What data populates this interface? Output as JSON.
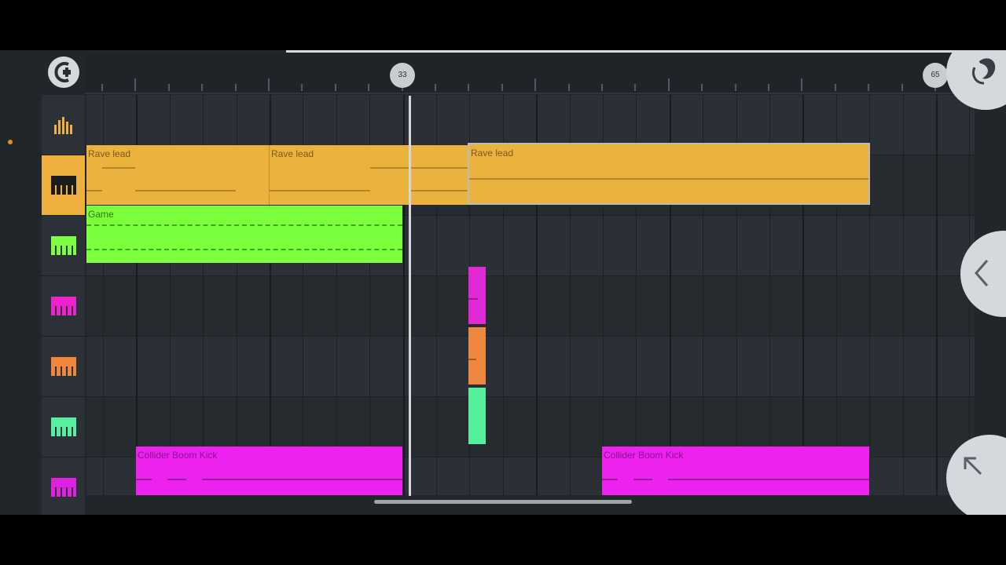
{
  "ruler": {
    "markers": [
      {
        "label": "33"
      },
      {
        "label": "65"
      }
    ]
  },
  "channels": [
    {
      "icon": "levels-icon",
      "color": "#f0b040"
    },
    {
      "icon": "piano-keys-icon",
      "color": "#1c1c1c"
    },
    {
      "icon": "piano-keys-icon",
      "color": "#7cff42"
    },
    {
      "icon": "piano-keys-icon",
      "color": "#ee22cc"
    },
    {
      "icon": "piano-keys-icon",
      "color": "#f0863c"
    },
    {
      "icon": "piano-keys-icon",
      "color": "#55f0a0"
    },
    {
      "icon": "piano-keys-icon",
      "color": "#e020e0"
    }
  ],
  "clips": {
    "rave_lead_1": {
      "label": "Rave lead"
    },
    "rave_lead_2": {
      "label": "Rave lead"
    },
    "rave_lead_3": {
      "label": "Rave lead"
    },
    "game": {
      "label": "Game"
    },
    "kick_1": {
      "label": "Collider Boom Kick"
    },
    "kick_2": {
      "label": "Collider Boom Kick"
    }
  },
  "colors": {
    "rave_lead": "#ecb23e",
    "game": "#7cff3c",
    "kick": "#ee22ee",
    "magenta_block": "#e02ad6",
    "orange_block": "#ee8840",
    "mint_block": "#56f09c"
  }
}
